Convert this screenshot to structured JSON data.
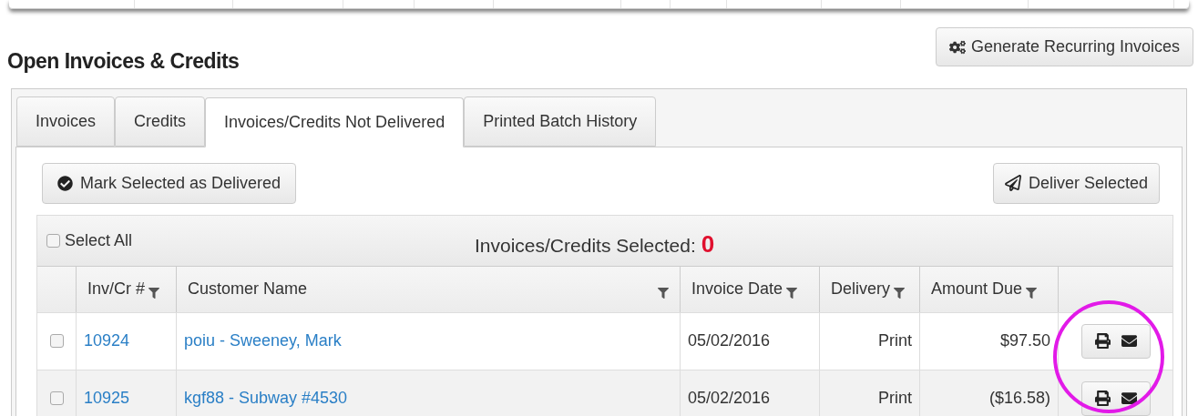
{
  "title": "Open Invoices & Credits",
  "generate_button": "Generate Recurring Invoices",
  "tabs": [
    {
      "label": "Invoices",
      "selected": false
    },
    {
      "label": "Credits",
      "selected": false
    },
    {
      "label": "Invoices/Credits Not Delivered",
      "selected": true
    },
    {
      "label": "Printed Batch History",
      "selected": false
    }
  ],
  "mark_button": "Mark Selected as Delivered",
  "deliver_button": "Deliver Selected",
  "select_all": {
    "label": "Select All",
    "checked": false
  },
  "selected_count": {
    "label": "Invoices/Credits Selected:",
    "value": "0"
  },
  "table": {
    "columns": [
      {
        "label": "Inv/Cr #"
      },
      {
        "label": "Customer Name"
      },
      {
        "label": "Invoice Date"
      },
      {
        "label": "Delivery"
      },
      {
        "label": "Amount Due"
      }
    ],
    "rows": [
      {
        "checked": false,
        "number": "10924",
        "customer": "poiu - Sweeney, Mark",
        "date": "05/02/2016",
        "delivery": "Print",
        "amount": "$97.50"
      },
      {
        "checked": false,
        "number": "10925",
        "customer": "kgf88 - Subway #4530",
        "date": "05/02/2016",
        "delivery": "Print",
        "amount": "($16.58)"
      }
    ]
  }
}
